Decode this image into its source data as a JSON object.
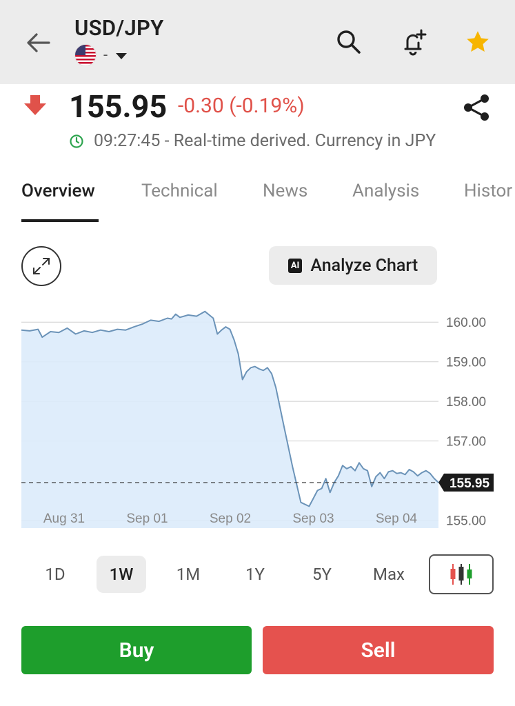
{
  "header": {
    "title": "USD/JPY",
    "subtitle": "-",
    "back_icon": "arrow-left-icon",
    "icons": [
      "search-icon",
      "bell-add-icon",
      "star-icon"
    ],
    "star_color": "#f7b500"
  },
  "quote": {
    "price": "155.95",
    "change": "-0.30 (-0.19%)",
    "direction": "down",
    "down_color": "#e0524a",
    "status_time": "09:27:45 - Real-time derived. Currency in JPY"
  },
  "tabs": [
    {
      "label": "Overview",
      "active": true
    },
    {
      "label": "Technical",
      "active": false
    },
    {
      "label": "News",
      "active": false
    },
    {
      "label": "Analysis",
      "active": false
    },
    {
      "label": "Histor",
      "active": false
    }
  ],
  "toolbar": {
    "ai_badge": "AI",
    "analyze_label": "Analyze Chart"
  },
  "chart_data": {
    "type": "area",
    "x_tick_labels": [
      "Aug 31",
      "Sep 01",
      "Sep 02",
      "Sep 03",
      "Sep 04"
    ],
    "y_tick_labels": [
      "160.00",
      "159.00",
      "158.00",
      "157.00",
      "155.00"
    ],
    "ylim": [
      154.8,
      160.3
    ],
    "current_label": "155.95",
    "current_value": 155.95,
    "line_color": "#6b93b8",
    "fill_color": "#dcebfb",
    "x": [
      0,
      0.02,
      0.04,
      0.05,
      0.07,
      0.09,
      0.11,
      0.13,
      0.15,
      0.17,
      0.19,
      0.21,
      0.23,
      0.25,
      0.27,
      0.29,
      0.31,
      0.33,
      0.35,
      0.36,
      0.37,
      0.38,
      0.4,
      0.42,
      0.44,
      0.46,
      0.47,
      0.48,
      0.49,
      0.5,
      0.51,
      0.52,
      0.53,
      0.54,
      0.55,
      0.56,
      0.57,
      0.58,
      0.59,
      0.6,
      0.61,
      0.63,
      0.65,
      0.67,
      0.69,
      0.7,
      0.71,
      0.72,
      0.73,
      0.74,
      0.75,
      0.76,
      0.77,
      0.78,
      0.79,
      0.8,
      0.81,
      0.82,
      0.83,
      0.84,
      0.85,
      0.86,
      0.87,
      0.88,
      0.89,
      0.9,
      0.91,
      0.92,
      0.93,
      0.94,
      0.95,
      0.96,
      0.97,
      0.98,
      0.99,
      1.0
    ],
    "values": [
      159.8,
      159.78,
      159.82,
      159.62,
      159.76,
      159.74,
      159.85,
      159.7,
      159.78,
      159.74,
      159.8,
      159.76,
      159.82,
      159.8,
      159.88,
      159.95,
      160.05,
      160.02,
      160.1,
      160.08,
      160.2,
      160.12,
      160.18,
      160.15,
      160.27,
      160.1,
      159.7,
      159.8,
      159.88,
      159.82,
      159.55,
      159.2,
      158.55,
      158.75,
      158.85,
      158.88,
      158.82,
      158.78,
      158.85,
      158.7,
      158.35,
      157.35,
      156.35,
      155.45,
      155.35,
      155.55,
      155.75,
      155.8,
      156.05,
      155.7,
      155.95,
      156.12,
      156.38,
      156.3,
      156.35,
      156.25,
      156.45,
      156.3,
      156.25,
      155.85,
      156.1,
      156.2,
      156.05,
      156.22,
      156.25,
      156.18,
      156.2,
      156.15,
      156.28,
      156.22,
      156.12,
      156.2,
      156.25,
      156.18,
      156.05,
      155.95
    ]
  },
  "ranges": [
    {
      "label": "1D",
      "active": false
    },
    {
      "label": "1W",
      "active": true
    },
    {
      "label": "1M",
      "active": false
    },
    {
      "label": "1Y",
      "active": false
    },
    {
      "label": "5Y",
      "active": false
    },
    {
      "label": "Max",
      "active": false
    }
  ],
  "actions": {
    "buy_label": "Buy",
    "buy_color": "#1e9e2c",
    "sell_label": "Sell",
    "sell_color": "#e5524e"
  }
}
